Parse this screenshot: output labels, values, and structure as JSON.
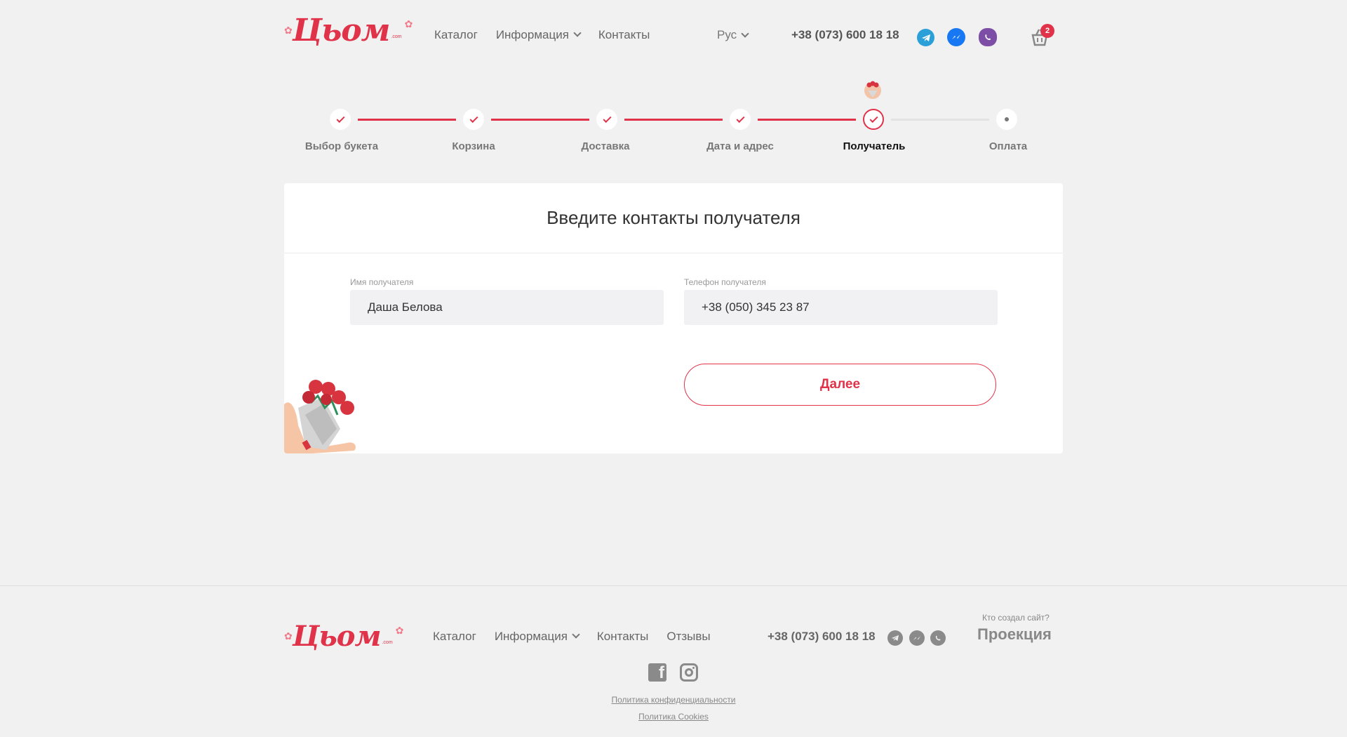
{
  "brand": {
    "logo_text": "Цьом",
    "logo_suffix": ".com"
  },
  "header": {
    "nav": [
      {
        "label": "Каталог"
      },
      {
        "label": "Информация",
        "has_dropdown": true
      },
      {
        "label": "Контакты"
      }
    ],
    "language": "Рус",
    "phone": "+38 (073) 600 18 18",
    "social": [
      "telegram-icon",
      "messenger-icon",
      "viber-icon"
    ],
    "cart_count": "2"
  },
  "stepper": {
    "steps": [
      {
        "label": "Выбор букета",
        "state": "done"
      },
      {
        "label": "Корзина",
        "state": "done"
      },
      {
        "label": "Доставка",
        "state": "done"
      },
      {
        "label": "Дата и адрес",
        "state": "done"
      },
      {
        "label": "Получатель",
        "state": "active"
      },
      {
        "label": "Оплата",
        "state": "pending"
      }
    ]
  },
  "form": {
    "title": "Введите контакты получателя",
    "name_label": "Имя получателя",
    "name_value": "Даша Белова",
    "phone_label": "Телефон получателя",
    "phone_value": "+38 (050) 345 23 87",
    "next_label": "Далее"
  },
  "footer": {
    "nav": [
      {
        "label": "Каталог"
      },
      {
        "label": "Информация",
        "has_dropdown": true
      },
      {
        "label": "Контакты"
      },
      {
        "label": "Отзывы"
      }
    ],
    "phone": "+38 (073) 600 18 18",
    "credit_question": "Кто создал сайт?",
    "credit_name": "Проекция",
    "privacy": "Политика конфиденциальности",
    "cookies": "Политика Cookies"
  },
  "colors": {
    "accent": "#e0334a",
    "telegram": "#2a9fd8",
    "messenger": "#1877f2",
    "viber": "#7d4ea5"
  }
}
